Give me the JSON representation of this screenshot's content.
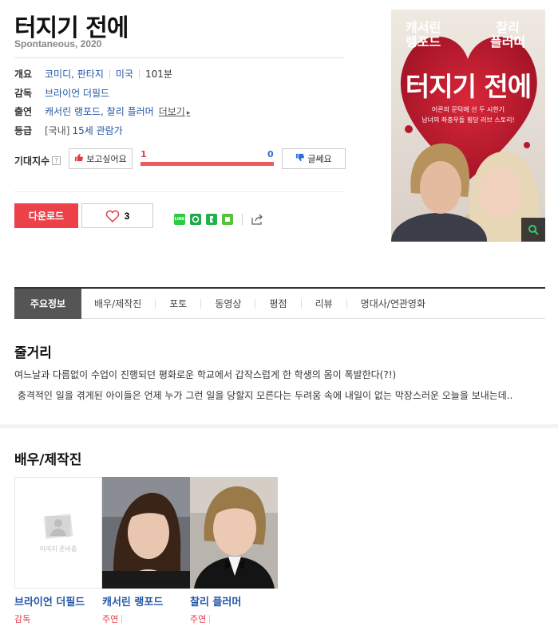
{
  "movie": {
    "title": "터지기 전에",
    "subtitle": "Spontaneous, 2020"
  },
  "info": {
    "overview_label": "개요",
    "genres": [
      "코미디",
      "판타지"
    ],
    "country": "미국",
    "runtime": "101분",
    "director_label": "감독",
    "director": "브라이언 더필드",
    "cast_label": "출연",
    "cast": "캐서린 랭포드, 찰리 플러머",
    "more_label": "더보기",
    "rating_label": "등급",
    "rating_prefix": "[국내]",
    "rating": "15세 관람가"
  },
  "expectation": {
    "label": "기대지수",
    "help_icon": "?",
    "want_label": "보고싶어요",
    "no_label": "글쎄요",
    "want_count": "1",
    "no_count": "0",
    "want_fraction": 1.0
  },
  "actions": {
    "download_label": "다운로드",
    "like_count": "3",
    "share_icons": [
      "line-icon",
      "band-icon",
      "kakaostory-icon",
      "blog-icon"
    ],
    "line_text": "LINE"
  },
  "poster": {
    "name1_line1": "캐서린",
    "name1_line2": "랭포드",
    "name2_line1": "찰리",
    "name2_line2": "플러머",
    "title": "터지기 전에",
    "tag1": "어른의 문턱에 선 두 시한기",
    "tag2": "남녀의 좌충우돌 횡당 러브 스토리!"
  },
  "tabs": [
    "주요정보",
    "배우/제작진",
    "포토",
    "동영상",
    "평점",
    "리뷰",
    "명대사/연관영화"
  ],
  "synopsis": {
    "heading": "줄거리",
    "line1": "여느날과 다름없이 수업이 진행되던 평화로운 학교에서 갑작스럽게 한 학생의 몸이 폭발한다(?!)",
    "line2": " 충격적인 일을 겪게된 아이들은 언제 누가 그런 일을 당할지 모른다는 두려움 속에 내일이 없는 막장스러운 오늘을 보내는데.."
  },
  "cast_section": {
    "heading": "배우/제작진",
    "no_image_text": "이미지 준비중",
    "people": [
      {
        "name": "브라이언 더필드",
        "role": "감독"
      },
      {
        "name": "캐서린 랭포드",
        "role": "주연"
      },
      {
        "name": "찰리 플러머",
        "role": "주연"
      }
    ]
  },
  "colors": {
    "accent_red": "#ec4149",
    "link_blue": "#2356a6",
    "vote_blue": "#2d6fd6"
  }
}
